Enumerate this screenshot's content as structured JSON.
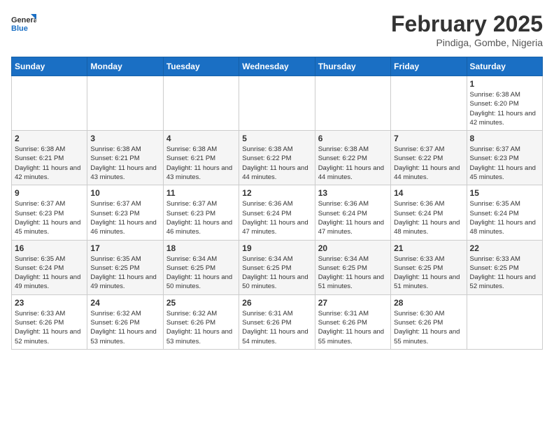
{
  "logo": {
    "general": "General",
    "blue": "Blue"
  },
  "header": {
    "month": "February 2025",
    "location": "Pindiga, Gombe, Nigeria"
  },
  "weekdays": [
    "Sunday",
    "Monday",
    "Tuesday",
    "Wednesday",
    "Thursday",
    "Friday",
    "Saturday"
  ],
  "weeks": [
    [
      {
        "day": "",
        "info": ""
      },
      {
        "day": "",
        "info": ""
      },
      {
        "day": "",
        "info": ""
      },
      {
        "day": "",
        "info": ""
      },
      {
        "day": "",
        "info": ""
      },
      {
        "day": "",
        "info": ""
      },
      {
        "day": "1",
        "info": "Sunrise: 6:38 AM\nSunset: 6:20 PM\nDaylight: 11 hours and 42 minutes."
      }
    ],
    [
      {
        "day": "2",
        "info": "Sunrise: 6:38 AM\nSunset: 6:21 PM\nDaylight: 11 hours and 42 minutes."
      },
      {
        "day": "3",
        "info": "Sunrise: 6:38 AM\nSunset: 6:21 PM\nDaylight: 11 hours and 43 minutes."
      },
      {
        "day": "4",
        "info": "Sunrise: 6:38 AM\nSunset: 6:21 PM\nDaylight: 11 hours and 43 minutes."
      },
      {
        "day": "5",
        "info": "Sunrise: 6:38 AM\nSunset: 6:22 PM\nDaylight: 11 hours and 44 minutes."
      },
      {
        "day": "6",
        "info": "Sunrise: 6:38 AM\nSunset: 6:22 PM\nDaylight: 11 hours and 44 minutes."
      },
      {
        "day": "7",
        "info": "Sunrise: 6:37 AM\nSunset: 6:22 PM\nDaylight: 11 hours and 44 minutes."
      },
      {
        "day": "8",
        "info": "Sunrise: 6:37 AM\nSunset: 6:23 PM\nDaylight: 11 hours and 45 minutes."
      }
    ],
    [
      {
        "day": "9",
        "info": "Sunrise: 6:37 AM\nSunset: 6:23 PM\nDaylight: 11 hours and 45 minutes."
      },
      {
        "day": "10",
        "info": "Sunrise: 6:37 AM\nSunset: 6:23 PM\nDaylight: 11 hours and 46 minutes."
      },
      {
        "day": "11",
        "info": "Sunrise: 6:37 AM\nSunset: 6:23 PM\nDaylight: 11 hours and 46 minutes."
      },
      {
        "day": "12",
        "info": "Sunrise: 6:36 AM\nSunset: 6:24 PM\nDaylight: 11 hours and 47 minutes."
      },
      {
        "day": "13",
        "info": "Sunrise: 6:36 AM\nSunset: 6:24 PM\nDaylight: 11 hours and 47 minutes."
      },
      {
        "day": "14",
        "info": "Sunrise: 6:36 AM\nSunset: 6:24 PM\nDaylight: 11 hours and 48 minutes."
      },
      {
        "day": "15",
        "info": "Sunrise: 6:35 AM\nSunset: 6:24 PM\nDaylight: 11 hours and 48 minutes."
      }
    ],
    [
      {
        "day": "16",
        "info": "Sunrise: 6:35 AM\nSunset: 6:24 PM\nDaylight: 11 hours and 49 minutes."
      },
      {
        "day": "17",
        "info": "Sunrise: 6:35 AM\nSunset: 6:25 PM\nDaylight: 11 hours and 49 minutes."
      },
      {
        "day": "18",
        "info": "Sunrise: 6:34 AM\nSunset: 6:25 PM\nDaylight: 11 hours and 50 minutes."
      },
      {
        "day": "19",
        "info": "Sunrise: 6:34 AM\nSunset: 6:25 PM\nDaylight: 11 hours and 50 minutes."
      },
      {
        "day": "20",
        "info": "Sunrise: 6:34 AM\nSunset: 6:25 PM\nDaylight: 11 hours and 51 minutes."
      },
      {
        "day": "21",
        "info": "Sunrise: 6:33 AM\nSunset: 6:25 PM\nDaylight: 11 hours and 51 minutes."
      },
      {
        "day": "22",
        "info": "Sunrise: 6:33 AM\nSunset: 6:25 PM\nDaylight: 11 hours and 52 minutes."
      }
    ],
    [
      {
        "day": "23",
        "info": "Sunrise: 6:33 AM\nSunset: 6:26 PM\nDaylight: 11 hours and 52 minutes."
      },
      {
        "day": "24",
        "info": "Sunrise: 6:32 AM\nSunset: 6:26 PM\nDaylight: 11 hours and 53 minutes."
      },
      {
        "day": "25",
        "info": "Sunrise: 6:32 AM\nSunset: 6:26 PM\nDaylight: 11 hours and 53 minutes."
      },
      {
        "day": "26",
        "info": "Sunrise: 6:31 AM\nSunset: 6:26 PM\nDaylight: 11 hours and 54 minutes."
      },
      {
        "day": "27",
        "info": "Sunrise: 6:31 AM\nSunset: 6:26 PM\nDaylight: 11 hours and 55 minutes."
      },
      {
        "day": "28",
        "info": "Sunrise: 6:30 AM\nSunset: 6:26 PM\nDaylight: 11 hours and 55 minutes."
      },
      {
        "day": "",
        "info": ""
      }
    ]
  ]
}
